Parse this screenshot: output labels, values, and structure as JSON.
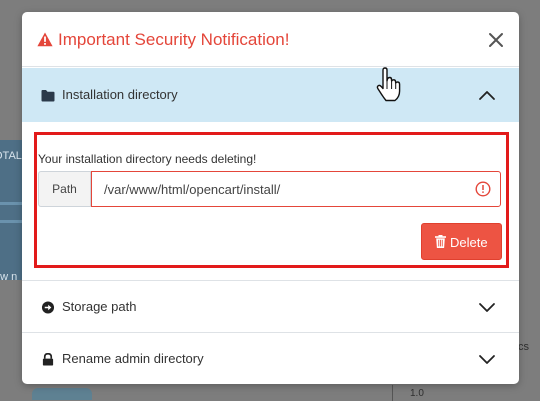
{
  "background": {
    "total_label": "OTAL",
    "view_label": "ew n",
    "side_label": "cs",
    "axis_tick": "1.0"
  },
  "modal": {
    "title": "Important Security Notification!",
    "title_color": "#e4463a",
    "close_icon": "close-icon"
  },
  "accordion": [
    {
      "label": "Installation directory",
      "icon": "folder-icon",
      "expanded": true,
      "message": "Your installation directory needs deleting!",
      "path_label": "Path",
      "path_value": "/var/www/html/opencart/install/",
      "delete_label": "Delete"
    },
    {
      "label": "Storage path",
      "icon": "arrow-circle-right-icon",
      "expanded": false
    },
    {
      "label": "Rename admin directory",
      "icon": "lock-icon",
      "expanded": false
    }
  ],
  "colors": {
    "danger": "#ed5443",
    "active_header": "#cfe8f5",
    "highlight": "#e21a1a"
  }
}
